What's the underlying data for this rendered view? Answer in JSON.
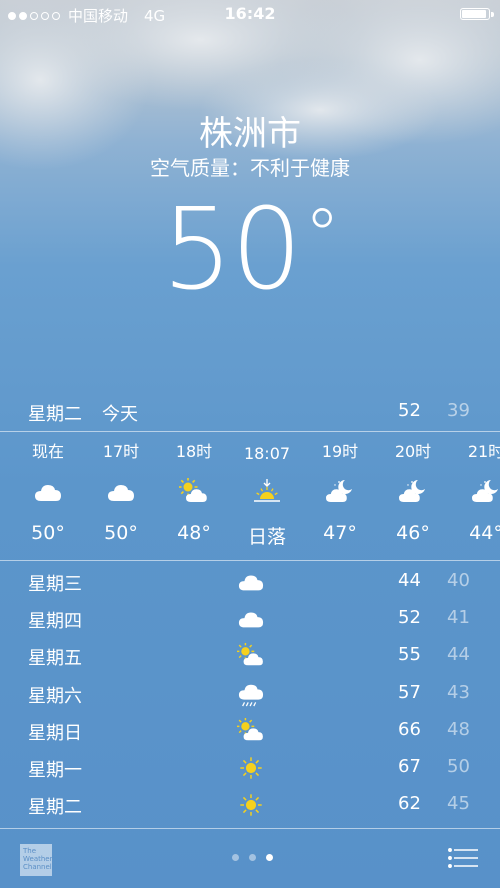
{
  "status": {
    "carrier": "中国移动",
    "network": "4G",
    "time": "16:42",
    "signal_bars": 2,
    "signal_total": 5,
    "battery_level": 0.95
  },
  "location": {
    "city": "株洲市",
    "air_quality": "空气质量：不利于健康"
  },
  "current": {
    "temperature": "50",
    "unit_symbol": "°"
  },
  "today": {
    "day": "星期二",
    "label": "今天",
    "high": "52",
    "low": "39"
  },
  "hourly": [
    {
      "time": "现在",
      "icon": "cloud-icon",
      "temp": "50°"
    },
    {
      "time": "17时",
      "icon": "cloud-icon",
      "temp": "50°"
    },
    {
      "time": "18时",
      "icon": "partly-sunny-icon",
      "temp": "48°"
    },
    {
      "time": "18:07",
      "icon": "sunset-icon",
      "temp": "日落"
    },
    {
      "time": "19时",
      "icon": "partly-cloudy-night-icon",
      "temp": "47°"
    },
    {
      "time": "20时",
      "icon": "partly-cloudy-night-icon",
      "temp": "46°"
    },
    {
      "time": "21时",
      "icon": "partly-cloudy-night-icon",
      "temp": "44°"
    }
  ],
  "daily": [
    {
      "day": "星期三",
      "icon": "cloud-icon",
      "high": "44",
      "low": "40"
    },
    {
      "day": "星期四",
      "icon": "cloud-icon",
      "high": "52",
      "low": "41"
    },
    {
      "day": "星期五",
      "icon": "partly-sunny-icon",
      "high": "55",
      "low": "44"
    },
    {
      "day": "星期六",
      "icon": "rain-icon",
      "high": "57",
      "low": "43"
    },
    {
      "day": "星期日",
      "icon": "partly-sunny-icon",
      "high": "66",
      "low": "48"
    },
    {
      "day": "星期一",
      "icon": "sun-icon",
      "high": "67",
      "low": "50"
    },
    {
      "day": "星期二",
      "icon": "sun-icon",
      "high": "62",
      "low": "45"
    }
  ],
  "footer": {
    "logo_text": "The Weather Channel",
    "page_count": 3,
    "active_page": 2
  },
  "colors": {
    "sun": "#f5d11e",
    "cloud": "#ffffff"
  }
}
